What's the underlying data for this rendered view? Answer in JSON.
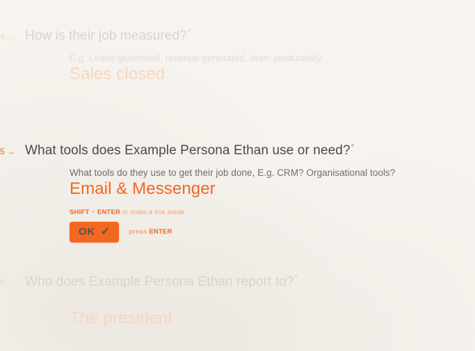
{
  "theme": {
    "background": "#f7f4ef",
    "accent": "#f4671f",
    "accent_bright": "#f26522",
    "accent_faded": "#f8d6c3",
    "text_dark": "#4a4a4a",
    "text_muted": "#6e6e6e",
    "text_faded": "#d9d4cd",
    "button_text": "#545454"
  },
  "questions": [
    {
      "number": "4",
      "arrow": "→",
      "title": "How is their job measured?",
      "required_marker": "*",
      "description": "E.g. Leads generated, revenue generated, team productivity",
      "answer": "Sales closed",
      "state": "answered"
    },
    {
      "number": "5",
      "arrow": "→",
      "title": "What tools does Example Persona Ethan use or need?",
      "required_marker": "*",
      "description": "What tools do they use to get their job done, E.g. CRM? Organisational tools?",
      "answer": "Email & Messenger",
      "state": "active",
      "hint": {
        "shift_key": "SHIFT",
        "plus": " + ",
        "enter_key": "ENTER",
        "suffix": " to make a line break"
      },
      "submit": {
        "label": "OK",
        "check_icon": "✓",
        "press_prefix": "press ",
        "press_key": "ENTER"
      }
    },
    {
      "number": "6",
      "arrow": "→",
      "title": "Who does Example Persona Ethan report to?",
      "required_marker": "*",
      "description": "",
      "answer": "The president",
      "state": "answered"
    }
  ]
}
